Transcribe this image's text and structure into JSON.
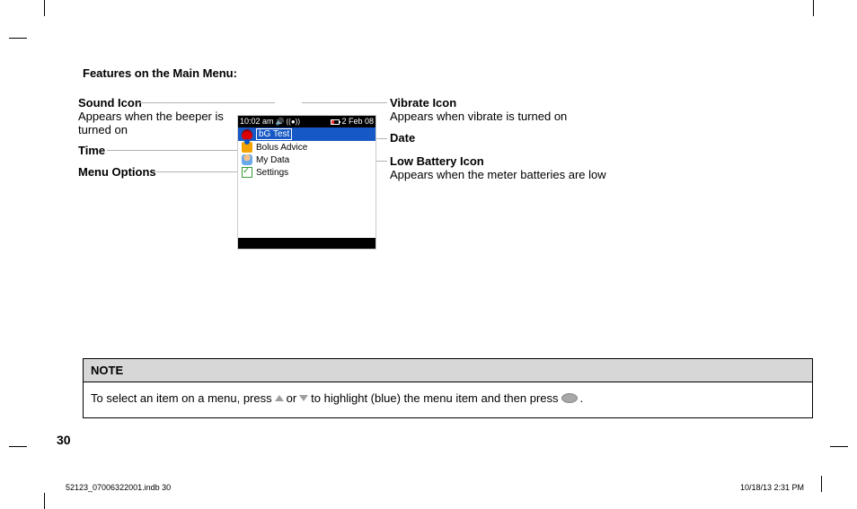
{
  "heading": "Features on the Main Menu:",
  "left_labels": {
    "sound": {
      "title": "Sound Icon",
      "desc": "Appears when the beeper is turned on"
    },
    "time": {
      "title": "Time"
    },
    "menu_options": {
      "title": "Menu Options"
    }
  },
  "right_labels": {
    "vibrate": {
      "title": "Vibrate Icon",
      "desc": "Appears when vibrate is turned on"
    },
    "date": {
      "title": "Date"
    },
    "low_battery": {
      "title": "Low Battery Icon",
      "desc": "Appears when the meter batteries are low"
    }
  },
  "device": {
    "status": {
      "time": "10:02 am",
      "date": "2 Feb 08"
    },
    "menu": {
      "items": [
        {
          "label": "bG Test",
          "selected": true
        },
        {
          "label": "Bolus Advice",
          "selected": false
        },
        {
          "label": "My Data",
          "selected": false
        },
        {
          "label": "Settings",
          "selected": false
        }
      ]
    }
  },
  "note": {
    "head": "NOTE",
    "body_pre": "To select an item on a menu, press",
    "body_mid": "or",
    "body_post": "to highlight (blue) the menu item and then press",
    "body_end": "."
  },
  "page_number": "30",
  "footer": {
    "left": "52123_07006322001.indb   30",
    "right": "10/18/13   2:31 PM"
  }
}
